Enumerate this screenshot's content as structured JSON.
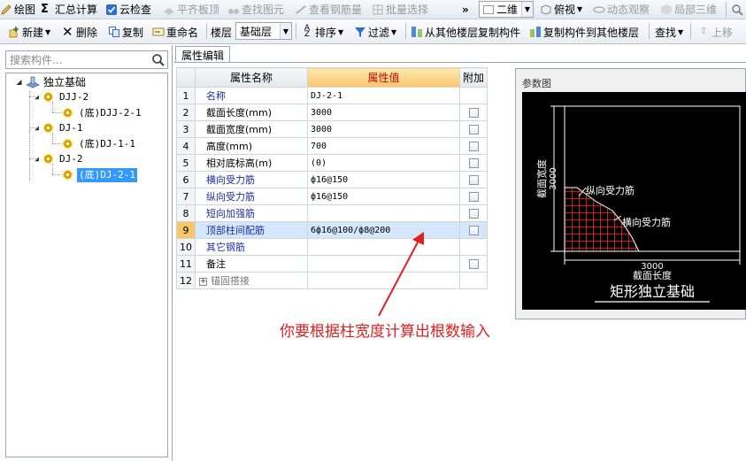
{
  "toolbar_top": {
    "draw": "绘图",
    "summary": "汇总计算",
    "cloud_check": "云检查",
    "flat_top": "平齐板顶",
    "find_element": "查找图元",
    "view_rebar": "查看钢筋量",
    "batch_select": "批量选择",
    "view_mode": "二维",
    "top_view": "俯视",
    "dynamic_view": "动态观察",
    "local_3d": "局部三维"
  },
  "toolbar_main": {
    "new": "新建",
    "delete": "删除",
    "copy": "复制",
    "rename": "重命名",
    "floor_label": "楼层",
    "floor_value": "基础层",
    "sort": "排序",
    "filter": "过滤",
    "copy_from_floor": "从其他楼层复制构件",
    "copy_to_floor": "复制构件到其他楼层",
    "find": "查找",
    "move_up": "上移"
  },
  "search": {
    "placeholder": "搜索构件..."
  },
  "tree": {
    "root": "独立基础",
    "items": [
      {
        "label": "DJJ-2",
        "child": "(底)DJJ-2-1"
      },
      {
        "label": "DJ-1",
        "child": "(底)DJ-1-1"
      },
      {
        "label": "DJ-2",
        "child": "(底)DJ-2-1"
      }
    ]
  },
  "tab": {
    "label": "属性编辑"
  },
  "grid": {
    "headers": {
      "name": "属性名称",
      "value": "属性值",
      "extra": "附加"
    },
    "rows": [
      {
        "no": "1",
        "name": "名称",
        "value": "DJ-2-1",
        "check": false
      },
      {
        "no": "2",
        "name": "截面长度(mm)",
        "value": "3000",
        "check": true
      },
      {
        "no": "3",
        "name": "截面宽度(mm)",
        "value": "3000",
        "check": true
      },
      {
        "no": "4",
        "name": "高度(mm)",
        "value": "700",
        "check": true
      },
      {
        "no": "5",
        "name": "相对底标高(m)",
        "value": "(0)",
        "check": true
      },
      {
        "no": "6",
        "name": "横向受力筋",
        "value": "ф16@150",
        "check": true
      },
      {
        "no": "7",
        "name": "纵向受力筋",
        "value": "ф16@150",
        "check": true
      },
      {
        "no": "8",
        "name": "短向加强筋",
        "value": "",
        "check": true
      },
      {
        "no": "9",
        "name": "顶部柱间配筋",
        "value": "6ф16@100/ф8@200",
        "check": true
      },
      {
        "no": "10",
        "name": "其它钢筋",
        "value": "",
        "check": false
      },
      {
        "no": "11",
        "name": "备注",
        "value": "",
        "check": true
      },
      {
        "no": "12",
        "name": "锚固搭接",
        "value": "",
        "check": false
      }
    ]
  },
  "param": {
    "title": "参数图",
    "width_label": "截面宽度",
    "width_value": "3000",
    "length_value": "3000",
    "length_label": "截面长度",
    "long_bar": "纵向受力筋",
    "trans_bar": "横向受力筋",
    "caption": "矩形独立基础"
  },
  "annotation": "你要根据柱宽度计算出根数输入",
  "colors": {
    "annotation": "#e02020",
    "selection": "#3399ff",
    "rebar": "#ff2020"
  }
}
